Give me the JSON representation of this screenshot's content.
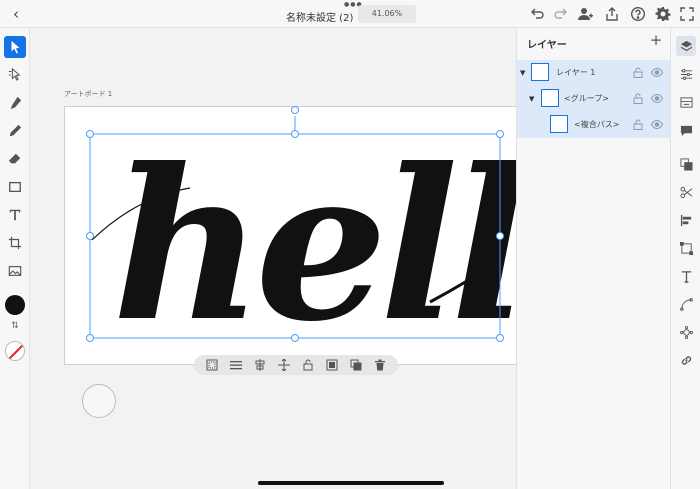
{
  "topbar": {
    "back_icon": "chevron-left-icon",
    "title": "名称未設定 (2)",
    "zoom": "41.06%",
    "icons": [
      "undo-icon",
      "redo-icon",
      "invite-user-icon",
      "share-icon",
      "help-icon",
      "settings-icon",
      "fit-screen-icon"
    ]
  },
  "tools": [
    "selection-icon",
    "direct-selection-icon",
    "pen-icon",
    "pencil-icon",
    "eraser-icon",
    "rectangle-icon",
    "type-icon",
    "crop-icon",
    "image-icon"
  ],
  "colors": {
    "fill": "#111111",
    "stroke": "none",
    "accent": "#1473e6"
  },
  "artboard": {
    "label": "アートボード 1"
  },
  "artwork": {
    "text": "hello"
  },
  "context_bar": {
    "icons": [
      "pattern-icon",
      "align-icon",
      "distribute-icon",
      "move-icon",
      "lock-icon",
      "image-trace-icon",
      "duplicate-icon",
      "delete-icon"
    ]
  },
  "layers": {
    "title": "レイヤー",
    "add_icon": "plus-icon",
    "items": [
      {
        "label": "レイヤー 1",
        "depth": 0,
        "expanded": true
      },
      {
        "label": "<グループ>",
        "depth": 1,
        "expanded": true
      },
      {
        "label": "<複合パス>",
        "depth": 2,
        "expanded": false
      }
    ]
  },
  "right_rail": {
    "icons": [
      "layers-icon",
      "properties-icon",
      "libraries-icon",
      "comments-icon",
      "arrange-icon",
      "cut-icon",
      "align-icon",
      "transform-icon",
      "type-properties-icon",
      "path-icon",
      "repeat-icon",
      "link-icon"
    ]
  }
}
